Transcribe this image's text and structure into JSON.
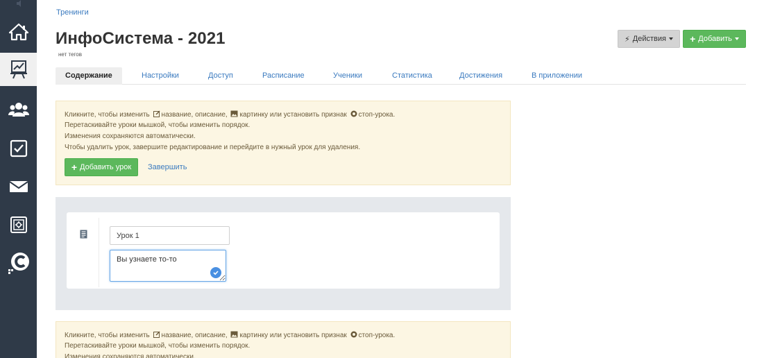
{
  "breadcrumb": "Тренинги",
  "title": "ИнфоСистема - 2021",
  "tags": "нет тегов",
  "actions_button": "Действия",
  "add_button": "Добавить",
  "tabs": [
    {
      "label": "Содержание",
      "active": true
    },
    {
      "label": "Настройки"
    },
    {
      "label": "Доступ"
    },
    {
      "label": "Расписание"
    },
    {
      "label": "Ученики"
    },
    {
      "label": "Статистика"
    },
    {
      "label": "Достижения"
    },
    {
      "label": "В приложении"
    }
  ],
  "info": {
    "line1_a": "Кликните, чтобы изменить",
    "line1_b": "название, описание,",
    "line1_c": "картинку или установить признак",
    "line1_d": "стоп-урока.",
    "line2": "Перетаскивайте уроки мышкой, чтобы изменить порядок.",
    "line3": "Изменения сохраняются автоматически.",
    "line4": "Чтобы удалить урок, завершите редактирование и перейдите в нужный урок для удаления."
  },
  "add_lesson_button": "Добавить урок",
  "finish_link": "Завершить",
  "lesson": {
    "title_value": "Урок 1",
    "description_value": "Вы узнаете то-то"
  },
  "colors": {
    "sidebar": "#2f3a48",
    "green": "#5cb85c",
    "link": "#3a7abf",
    "info_bg": "#fcf6e3"
  }
}
